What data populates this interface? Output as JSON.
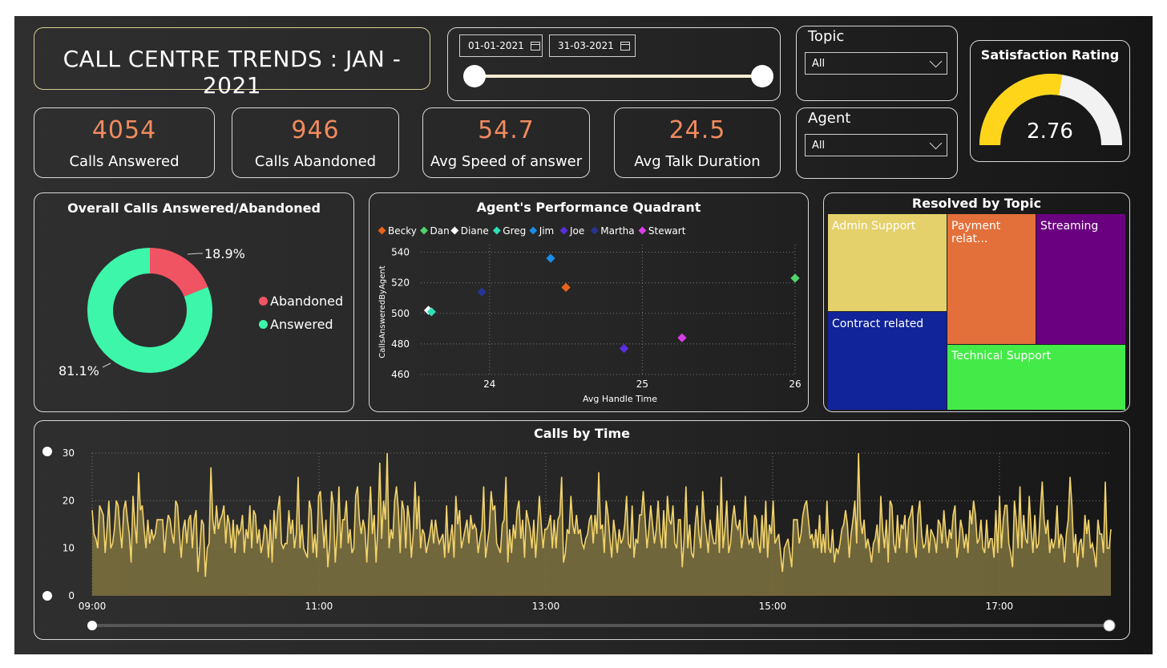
{
  "header": {
    "title": "CALL CENTRE TRENDS : JAN - 2021"
  },
  "date_range": {
    "start": "01-01-2021",
    "end": "31-03-2021"
  },
  "filters": {
    "topic": {
      "label": "Topic",
      "value": "All"
    },
    "agent": {
      "label": "Agent",
      "value": "All"
    }
  },
  "kpis": [
    {
      "value": "4054",
      "label": "Calls Answered"
    },
    {
      "value": "946",
      "label": "Calls Abandoned"
    },
    {
      "value": "54.7",
      "label": "Avg Speed of answer"
    },
    {
      "value": "24.5",
      "label": "Avg Talk Duration"
    }
  ],
  "satisfaction": {
    "title": "Satisfaction Rating",
    "value": "2.76",
    "max": 5
  },
  "donut": {
    "title": "Overall Calls Answered/Abandoned",
    "slices": [
      {
        "name": "Abandoned",
        "pct": 18.9,
        "label": "18.9%",
        "color": "#f05462"
      },
      {
        "name": "Answered",
        "pct": 81.1,
        "label": "81.1%",
        "color": "#3df6aa"
      }
    ]
  },
  "quadrant": {
    "title": "Agent's Performance Quadrant",
    "xlabel": "Avg Handle Time",
    "ylabel": "CallsAnsweredByAgent",
    "xticks": [
      "24",
      "25",
      "26"
    ],
    "yticks": [
      "540",
      "520",
      "500",
      "480",
      "460"
    ],
    "agents": [
      {
        "name": "Becky",
        "color": "#e8641a"
      },
      {
        "name": "Dan",
        "color": "#4fd36a"
      },
      {
        "name": "Diane",
        "color": "#ffffff"
      },
      {
        "name": "Greg",
        "color": "#2ee0b4"
      },
      {
        "name": "Jim",
        "color": "#1b8de8"
      },
      {
        "name": "Joe",
        "color": "#5b2ee0"
      },
      {
        "name": "Martha",
        "color": "#263593"
      },
      {
        "name": "Stewart",
        "color": "#d83ee8"
      }
    ]
  },
  "treemap": {
    "title": "Resolved by Topic",
    "tiles": [
      {
        "label": "Admin Support",
        "color": "#e5d16b"
      },
      {
        "label": "Payment relat...",
        "color": "#e3703a"
      },
      {
        "label": "Streaming",
        "color": "#6a0080"
      },
      {
        "label": "Contract related",
        "color": "#11249a"
      },
      {
        "label": "Technical Support",
        "color": "#44ea47"
      }
    ]
  },
  "timeline": {
    "title": "Calls by Time"
  },
  "chart_data": [
    {
      "type": "pie",
      "title": "Overall Calls Answered/Abandoned",
      "categories": [
        "Abandoned",
        "Answered"
      ],
      "values": [
        18.9,
        81.1
      ]
    },
    {
      "type": "scatter",
      "title": "Agent's Performance Quadrant",
      "xlabel": "Avg Handle Time",
      "ylabel": "CallsAnsweredByAgent",
      "xlim": [
        23.55,
        26
      ],
      "ylim": [
        460,
        545
      ],
      "series": [
        {
          "name": "Becky",
          "x": [
            24.5
          ],
          "y": [
            517
          ]
        },
        {
          "name": "Dan",
          "x": [
            26.0
          ],
          "y": [
            523
          ]
        },
        {
          "name": "Diane",
          "x": [
            23.6
          ],
          "y": [
            502
          ]
        },
        {
          "name": "Greg",
          "x": [
            23.62
          ],
          "y": [
            501
          ]
        },
        {
          "name": "Jim",
          "x": [
            24.4
          ],
          "y": [
            536
          ]
        },
        {
          "name": "Joe",
          "x": [
            24.88
          ],
          "y": [
            477
          ]
        },
        {
          "name": "Martha",
          "x": [
            23.95
          ],
          "y": [
            514
          ]
        },
        {
          "name": "Stewart",
          "x": [
            25.26
          ],
          "y": [
            484
          ]
        }
      ]
    },
    {
      "type": "area",
      "title": "Calls by Time",
      "x_ticks": [
        "09:00",
        "11:00",
        "13:00",
        "15:00",
        "17:00"
      ],
      "y_ticks": [
        "30",
        "20",
        "10",
        "0"
      ],
      "ylim": [
        0,
        30
      ],
      "x_start_minutes": 540,
      "x_end_minutes": 1079,
      "values": [
        18,
        13,
        12,
        10,
        19,
        18,
        17,
        9,
        14,
        20,
        10,
        11,
        14,
        20,
        19,
        14,
        10,
        18,
        20,
        16,
        13,
        7,
        21,
        15,
        11,
        26,
        18,
        19,
        14,
        10,
        16,
        11,
        14,
        12,
        13,
        16,
        16,
        16,
        16,
        9,
        14,
        17,
        16,
        13,
        11,
        20,
        19,
        13,
        8,
        14,
        16,
        11,
        16,
        17,
        10,
        16,
        18,
        5,
        10,
        16,
        15,
        4,
        10,
        11,
        27,
        16,
        13,
        19,
        14,
        16,
        17,
        19,
        11,
        17,
        15,
        10,
        16,
        9,
        15,
        13,
        14,
        17,
        9,
        14,
        12,
        19,
        10,
        18,
        17,
        11,
        14,
        9,
        11,
        15,
        14,
        8,
        16,
        7,
        18,
        12,
        18,
        21,
        11,
        10,
        11,
        11,
        18,
        13,
        16,
        10,
        13,
        25,
        10,
        15,
        10,
        9,
        8,
        20,
        18,
        9,
        13,
        8,
        21,
        22,
        16,
        10,
        16,
        6,
        11,
        22,
        19,
        7,
        13,
        23,
        10,
        16,
        16,
        20,
        11,
        14,
        9,
        10,
        21,
        23,
        16,
        13,
        16,
        14,
        7,
        15,
        23,
        13,
        17,
        7,
        15,
        28,
        12,
        20,
        16,
        30,
        10,
        14,
        12,
        20,
        23,
        18,
        9,
        20,
        18,
        10,
        19,
        16,
        8,
        13,
        24,
        14,
        21,
        10,
        14,
        13,
        9,
        11,
        13,
        16,
        11,
        16,
        13,
        11,
        12,
        13,
        8,
        19,
        9,
        12,
        15,
        8,
        21,
        15,
        18,
        10,
        12,
        14,
        16,
        11,
        17,
        14,
        15,
        14,
        9,
        12,
        14,
        23,
        8,
        11,
        14,
        22,
        18,
        19,
        11,
        10,
        9,
        15,
        16,
        25,
        7,
        14,
        9,
        15,
        12,
        18,
        20,
        12,
        16,
        8,
        18,
        16,
        14,
        10,
        16,
        8,
        14,
        21,
        15,
        10,
        14,
        14,
        15,
        17,
        10,
        16,
        10,
        16,
        17,
        25,
        7,
        9,
        14,
        13,
        21,
        15,
        13,
        17,
        13,
        14,
        11,
        10,
        12,
        13,
        16,
        17,
        11,
        17,
        13,
        26,
        14,
        15,
        9,
        20,
        17,
        12,
        8,
        16,
        13,
        9,
        14,
        11,
        12,
        15,
        21,
        11,
        10,
        19,
        8,
        12,
        11,
        17,
        17,
        22,
        16,
        10,
        14,
        19,
        15,
        11,
        14,
        20,
        13,
        10,
        18,
        10,
        21,
        16,
        15,
        19,
        11,
        10,
        16,
        16,
        6,
        12,
        23,
        10,
        15,
        9,
        8,
        15,
        19,
        13,
        10,
        22,
        16,
        13,
        9,
        16,
        13,
        11,
        11,
        19,
        9,
        25,
        10,
        14,
        20,
        9,
        11,
        16,
        19,
        15,
        14,
        16,
        10,
        13,
        21,
        13,
        11,
        12,
        10,
        17,
        16,
        11,
        9,
        17,
        10,
        20,
        8,
        15,
        13,
        20,
        11,
        12,
        13,
        9,
        5,
        10,
        11,
        12,
        9,
        6,
        16,
        16,
        16,
        11,
        13,
        17,
        19,
        20,
        16,
        12,
        13,
        10,
        14,
        10,
        17,
        9,
        13,
        9,
        20,
        10,
        9,
        14,
        7,
        10,
        9,
        11,
        14,
        15,
        18,
        15,
        8,
        13,
        16,
        20,
        11,
        30,
        16,
        13,
        16,
        10,
        12,
        10,
        7,
        11,
        12,
        15,
        9,
        21,
        14,
        10,
        16,
        7,
        20,
        19,
        11,
        9,
        17,
        10,
        15,
        14,
        17,
        9,
        16,
        17,
        19,
        11,
        8,
        17,
        20,
        13,
        10,
        11,
        15,
        9,
        14,
        13,
        12,
        9,
        16,
        15,
        11,
        18,
        13,
        10,
        14,
        12,
        17,
        19,
        8,
        11,
        16,
        14,
        10,
        13,
        9,
        18,
        15,
        20,
        17,
        11,
        12,
        16,
        10,
        9,
        16,
        10,
        12,
        12,
        8,
        18,
        9,
        21,
        10,
        16,
        19,
        19,
        11,
        9,
        6,
        20,
        16,
        10,
        23,
        10,
        17,
        12,
        11,
        21,
        14,
        9,
        17,
        10,
        11,
        18,
        24,
        16,
        13,
        16,
        9,
        12,
        10,
        12,
        19,
        10,
        13,
        12,
        7,
        13,
        16,
        25,
        19,
        9,
        13,
        6,
        11,
        12,
        8,
        17,
        13,
        16,
        10,
        11,
        9,
        6,
        16,
        13,
        13,
        9,
        24,
        10,
        10,
        14
      ]
    }
  ]
}
